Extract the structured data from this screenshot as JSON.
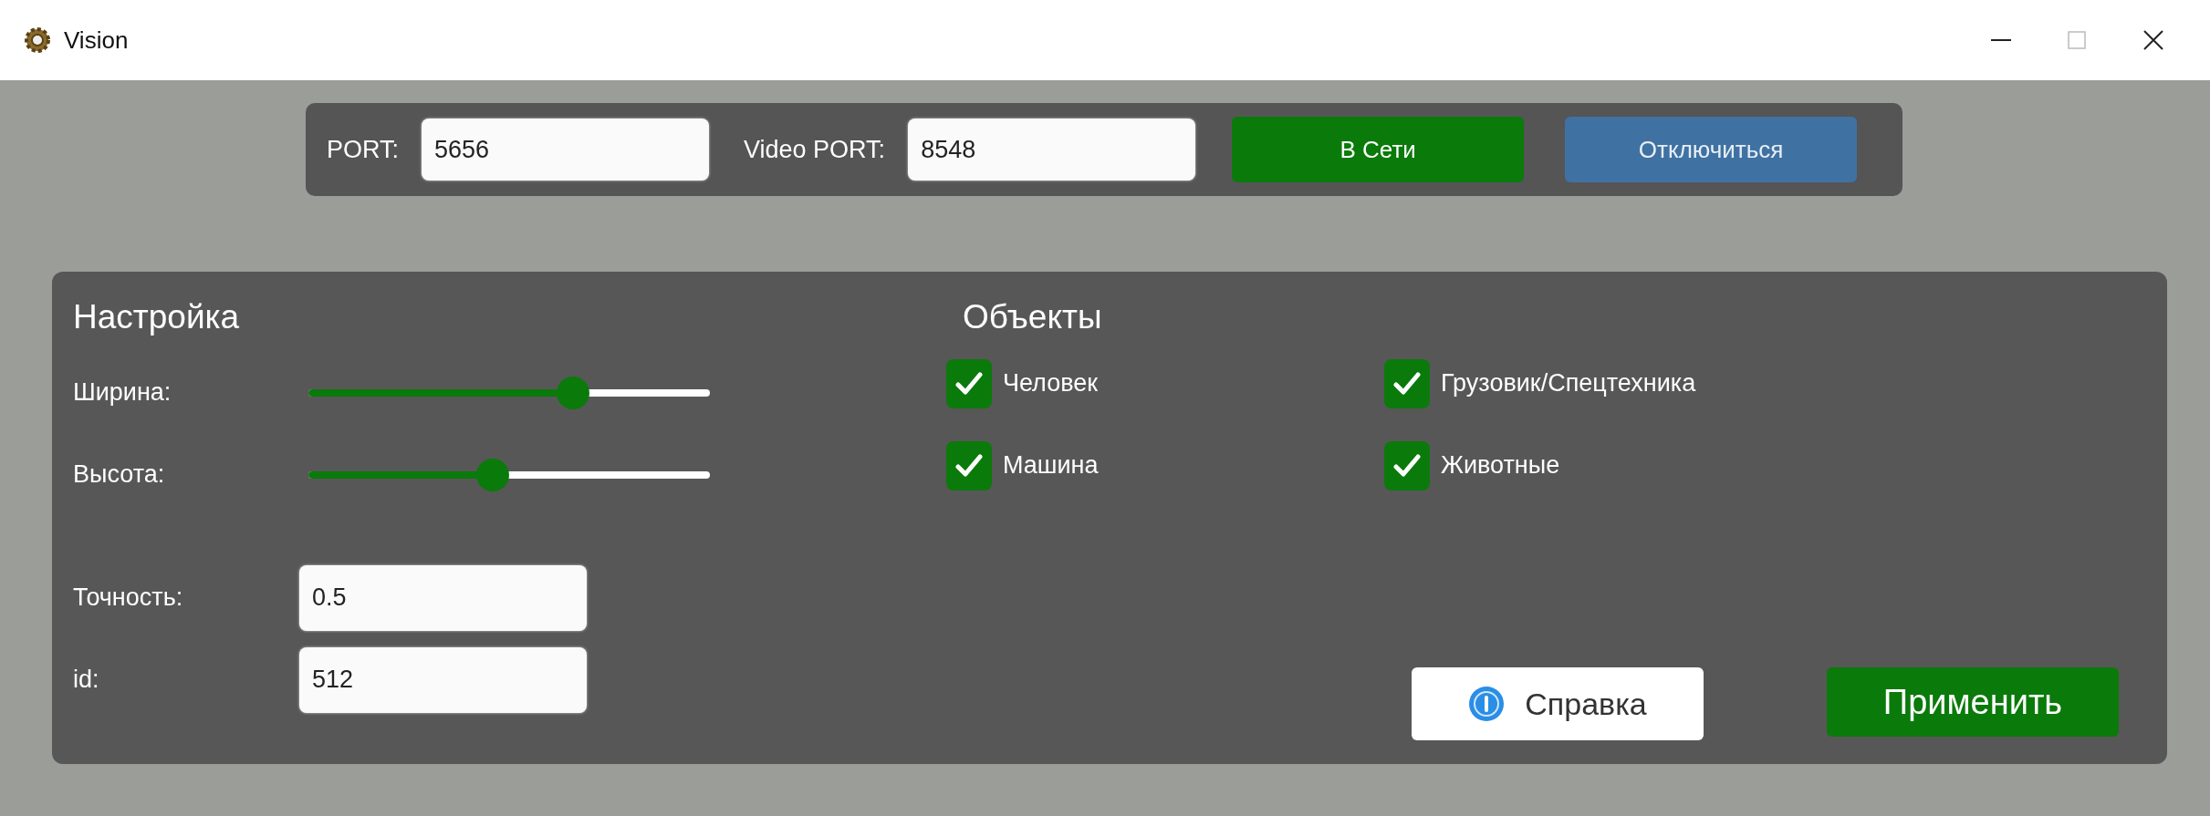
{
  "window": {
    "title": "Vision"
  },
  "connection": {
    "port_label": "PORT:",
    "port": "5656",
    "video_port_label": "Video PORT:",
    "video_port": "8548",
    "online_button": "В Сети",
    "disconnect_button": "Отключиться"
  },
  "settings": {
    "title": "Настройка",
    "sliders": [
      {
        "label": "Ширина:",
        "level": 0.66
      },
      {
        "label": "Высота:",
        "level": 0.46
      }
    ],
    "fields": [
      {
        "label": "Точность:",
        "value": "0.5"
      },
      {
        "label": "id:",
        "value": "512"
      }
    ]
  },
  "objects": {
    "title": "Объекты",
    "items": [
      {
        "label": "Человек",
        "checked": true
      },
      {
        "label": "Грузовик/Спецтехника",
        "checked": true
      },
      {
        "label": "Машина",
        "checked": true
      },
      {
        "label": "Животные",
        "checked": true
      }
    ]
  },
  "buttons": {
    "help": "Справка",
    "apply": "Применить"
  }
}
